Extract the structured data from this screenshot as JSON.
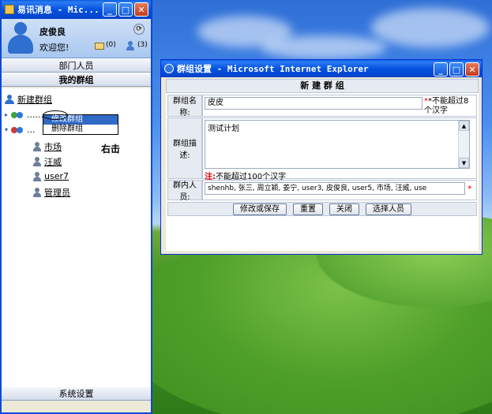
{
  "im_window": {
    "title": "易讯消息 - Mic...",
    "user_name": "皮俊良",
    "welcome": "欢迎您!",
    "mail_count": "(0)",
    "online_count": "(3)",
    "tab_department": "部门人员",
    "tab_my_groups": "我的群组",
    "new_group": "新建群组",
    "group1_label": "......",
    "group2_label": "...",
    "members": [
      "市场",
      "汪威",
      "user7",
      "管理员"
    ],
    "context_menu": {
      "edit_group": "修改群组",
      "delete_group": "删除群组"
    },
    "annotation_right_click": "右击",
    "footer": "系统设置"
  },
  "ie_dialog": {
    "title": "群组设置 - Microsoft Internet Explorer",
    "heading": "新 建 群 组",
    "name_label": "群组名称:",
    "name_value": "皮皮",
    "name_hint": "*不能超过8个汉字",
    "desc_label": "群组描述:",
    "desc_value": "测试计划",
    "desc_note_prefix": "注:",
    "desc_note": "不能超过100个汉字",
    "members_label": "群内人员:",
    "members_value": "shenhb, 张三, 周立颖, 姜宁, user3, 皮俊良, user5, 市场, 汪威, use",
    "members_star": "*",
    "buttons": {
      "save": "修改或保存",
      "reset": "重置",
      "close": "关闭",
      "select": "选择人员"
    }
  },
  "colors": {
    "titlebar": "#0553e0",
    "form_label_bg": "#e6ebf2",
    "required_red": "#e00000",
    "menu_highlight": "#316ac5"
  }
}
